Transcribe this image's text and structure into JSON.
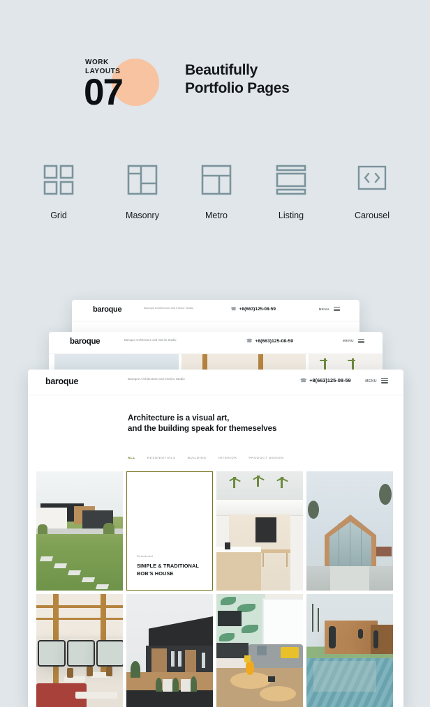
{
  "promo": {
    "kicker_line1": "WORK",
    "kicker_line2": "LAYOUTS",
    "number": "07",
    "title_line1": "Beautifully",
    "title_line2": "Portfolio Pages",
    "accent_circle_color": "#f8c3a0"
  },
  "layouts": {
    "icon_color": "#7b939c",
    "items": [
      {
        "label": "Grid",
        "icon": "grid-layout-icon"
      },
      {
        "label": "Masonry",
        "icon": "masonry-layout-icon"
      },
      {
        "label": "Metro",
        "icon": "metro-layout-icon"
      },
      {
        "label": "Listing",
        "icon": "listing-layout-icon"
      },
      {
        "label": "Carousel",
        "icon": "carousel-layout-icon"
      }
    ]
  },
  "site": {
    "logo": "baroque",
    "tagline": "Baroque Architecture and Interior Studio",
    "phone": "+8(663)125-08-59",
    "phone_icon": "phone-icon",
    "menu_label": "MENU",
    "menu_icon": "hamburger-icon",
    "hero_line1": "Architecture is a visual art,",
    "hero_line2": "and the building speak for themeselves",
    "filters": [
      "ALL",
      "RESIDENTIALS",
      "BUILDING",
      "INTERIOR",
      "PRODUCT DESIGN"
    ],
    "active_filter": "ALL",
    "active_filter_color": "#6f6f1f",
    "hover_card": {
      "category": "Residential",
      "title_line1": "SIMPLE & TRADITIONAL",
      "title_line2": "BOB'S HOUSE",
      "border_color": "#7a7724"
    },
    "portfolio_items": [
      {
        "name": "modern-house-lawn-photo"
      },
      {
        "name": "hovered-project-card"
      },
      {
        "name": "white-terrace-kitchen-photo"
      },
      {
        "name": "a-frame-glass-house-photo"
      },
      {
        "name": "wooden-beam-cafe-photo"
      },
      {
        "name": "black-townhouse-photo"
      },
      {
        "name": "living-room-interior-photo"
      },
      {
        "name": "wooden-cube-pool-photo"
      }
    ]
  },
  "theme": {
    "page_background": "#e0e6e9"
  }
}
